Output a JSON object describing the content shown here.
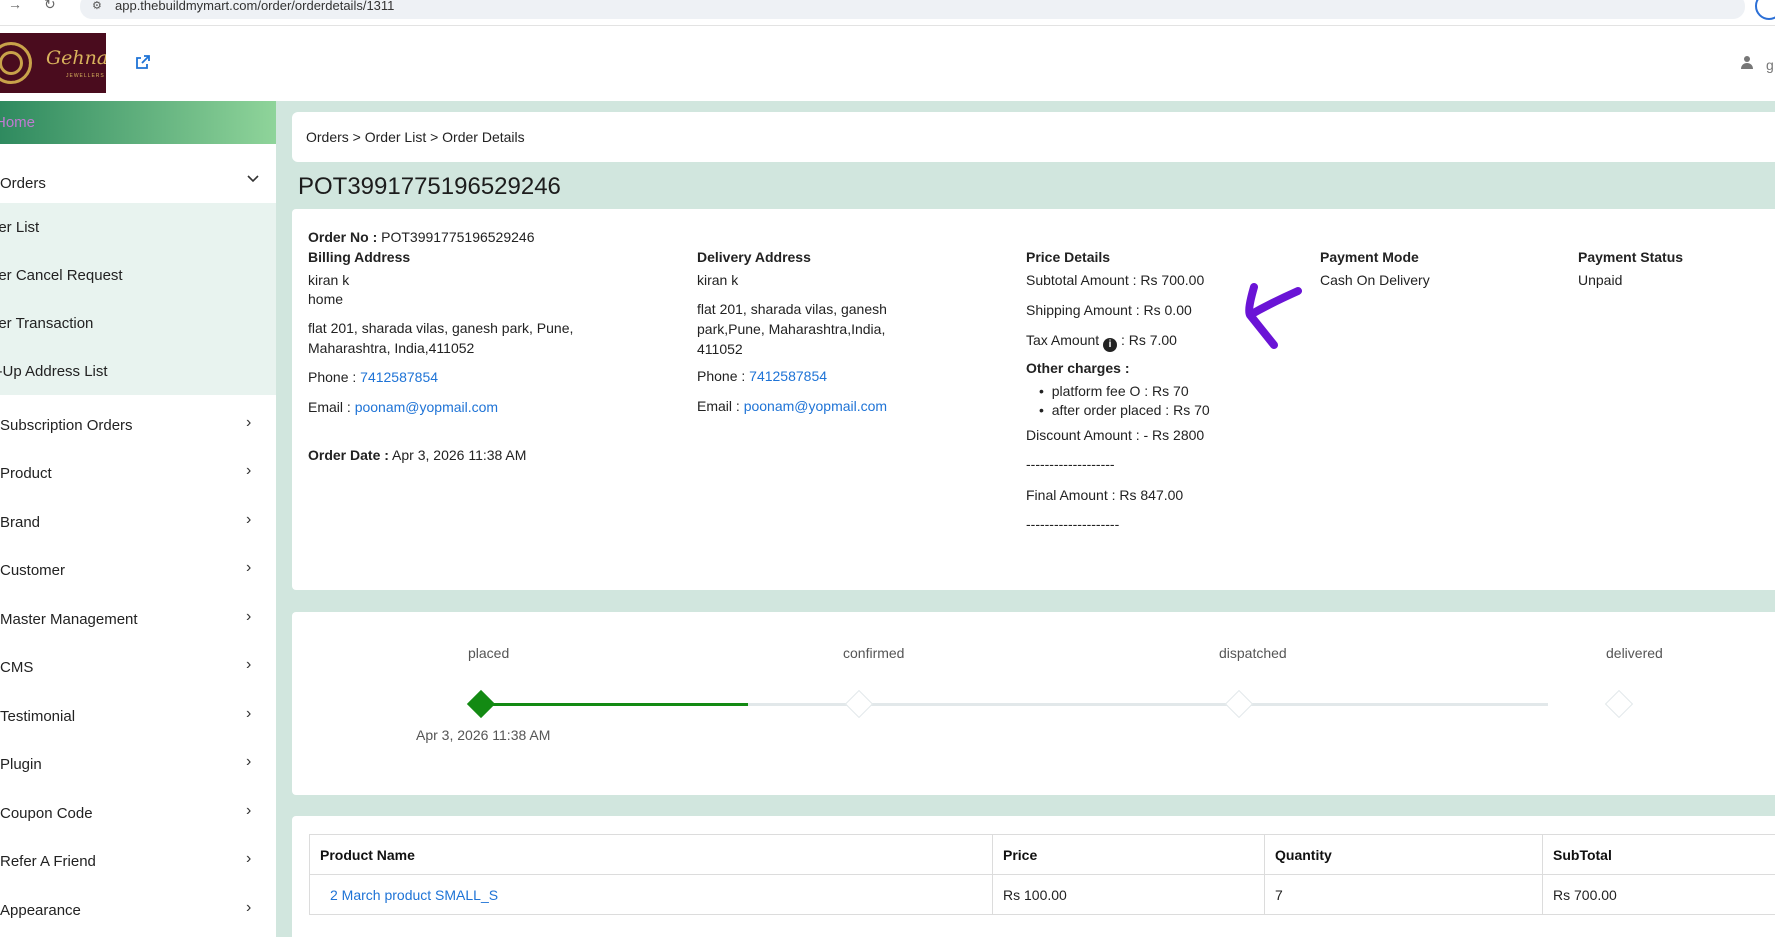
{
  "browser": {
    "url": "app.thebuildmymart.com/order/orderdetails/1311",
    "back_icon": "arrow-right-icon",
    "reload_icon": "reload-icon"
  },
  "header": {
    "logo_text": "Gehna",
    "logo_subtext": "JEWELLERS",
    "external_link_icon": "external-link-icon",
    "user_icon": "user-icon",
    "user_name_truncated": "g"
  },
  "sidebar": {
    "home": "Home",
    "orders": "Orders",
    "orders_sub": [
      "der List",
      "der Cancel Request",
      "der Transaction",
      "k-Up Address List"
    ],
    "items": [
      "Subscription Orders",
      "Product",
      "Brand",
      "Customer",
      " Master Management",
      "CMS",
      "Testimonial",
      "Plugin",
      "Coupon Code",
      " Refer A Friend",
      "Appearance"
    ]
  },
  "breadcrumb": "Orders > Order List > Order Details",
  "order": {
    "title": "POT3991775196529246",
    "order_no_label": "Order No :",
    "order_no": "POT3991775196529246",
    "billing": {
      "heading": "Billing Address",
      "name": "kiran k",
      "type": "home",
      "address": "flat 201, sharada vilas, ganesh park, Pune, Maharashtra, India,411052",
      "phone_label": "Phone :",
      "phone": "7412587854",
      "email_label": "Email :",
      "email": "poonam@yopmail.com"
    },
    "order_date_label": "Order Date :",
    "order_date": "Apr 3, 2026 11:38 AM",
    "delivery": {
      "heading": "Delivery Address",
      "name": "kiran k",
      "address": "flat 201, sharada vilas, ganesh park,Pune, Maharashtra,India, 411052",
      "phone_label": "Phone :",
      "phone": "7412587854",
      "email_label": "Email :",
      "email": "poonam@yopmail.com"
    },
    "price": {
      "heading": "Price Details",
      "subtotal": "Subtotal Amount : Rs 700.00",
      "shipping": "Shipping Amount : Rs 0.00",
      "tax_label": "Tax Amount",
      "tax_value": ": Rs  7.00",
      "other_heading": "Other charges :",
      "other": [
        "platform fee O :  Rs  70",
        "after order placed :  Rs  70"
      ],
      "discount": "Discount Amount : - Rs 2800",
      "separator1": "-------------------",
      "final": "Final Amount : Rs  847.00",
      "separator2": "--------------------"
    },
    "payment_mode_heading": "Payment Mode",
    "payment_mode": "Cash On Delivery",
    "payment_status_heading": "Payment Status",
    "payment_status": "Unpaid"
  },
  "timeline": {
    "stages": [
      "placed",
      "confirmed",
      "dispatched",
      "delivered"
    ],
    "placed_date": "Apr 3, 2026 11:38 AM",
    "progress": 0.25,
    "colors": {
      "active": "#138a13",
      "inactive": "#e2e8ea"
    }
  },
  "products": {
    "headers": [
      "Product Name",
      "Price",
      "Quantity",
      "SubTotal"
    ],
    "rows": [
      {
        "name": "2 March product SMALL_S",
        "price": "Rs 100.00",
        "quantity": "7",
        "subtotal": "Rs 700.00"
      }
    ]
  },
  "colors": {
    "accent": "#1e73d6",
    "annotation_arrow": "#6a14d6",
    "logo_bg": "#4a0c1e"
  }
}
